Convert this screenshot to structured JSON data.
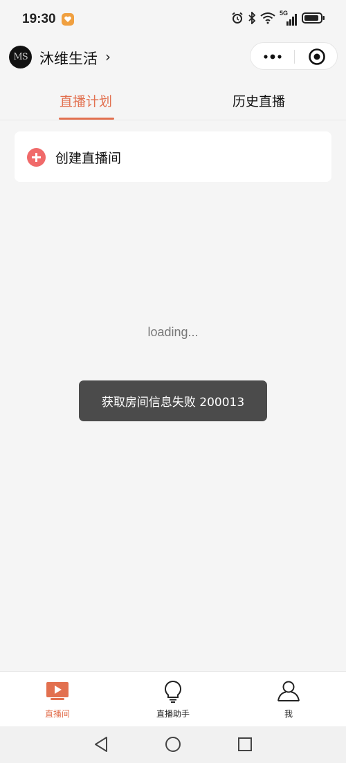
{
  "status_bar": {
    "time": "19:30",
    "network_label": "5G",
    "icons": [
      "alarm-icon",
      "bluetooth-icon",
      "wifi-icon",
      "signal-icon",
      "battery-icon"
    ]
  },
  "header": {
    "avatar_initials": "MS",
    "title": "沐维生活",
    "chevron": "›"
  },
  "tabs": [
    {
      "label": "直播计划",
      "active": true
    },
    {
      "label": "历史直播",
      "active": false
    }
  ],
  "create_card": {
    "label": "创建直播间"
  },
  "loading_text": "loading...",
  "toast_text": "获取房间信息失败 200013",
  "tabbar": {
    "items": [
      {
        "label": "直播间",
        "icon": "tv-play-icon",
        "active": true
      },
      {
        "label": "直播助手",
        "icon": "lightbulb-icon",
        "active": false
      },
      {
        "label": "我",
        "icon": "person-icon",
        "active": false
      }
    ]
  },
  "colors": {
    "accent": "#e2704f",
    "plus": "#f06a6a",
    "toast_bg": "#4b4b4b",
    "background": "#f5f5f5"
  }
}
